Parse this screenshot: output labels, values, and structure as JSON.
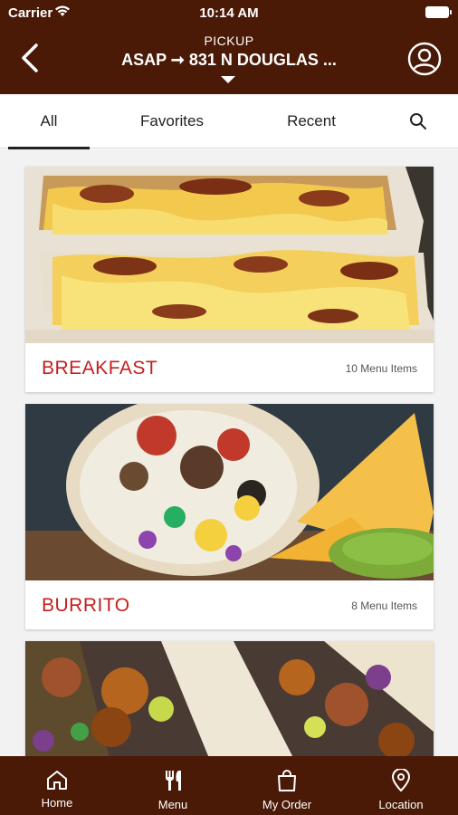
{
  "status_bar": {
    "carrier": "Carrier",
    "time": "10:14 AM"
  },
  "header": {
    "mode": "PICKUP",
    "address": "ASAP ➞ 831 N DOUGLAS ..."
  },
  "tabs": [
    {
      "label": "All"
    },
    {
      "label": "Favorites"
    },
    {
      "label": "Recent"
    }
  ],
  "categories": [
    {
      "title": "BREAKFAST",
      "count": "10 Menu Items"
    },
    {
      "title": "BURRITO",
      "count": "8 Menu Items"
    }
  ],
  "bottom_nav": [
    {
      "label": "Home"
    },
    {
      "label": "Menu"
    },
    {
      "label": "My Order"
    },
    {
      "label": "Location"
    }
  ],
  "colors": {
    "brand": "#4a1a06",
    "accent": "#c41e1e"
  }
}
